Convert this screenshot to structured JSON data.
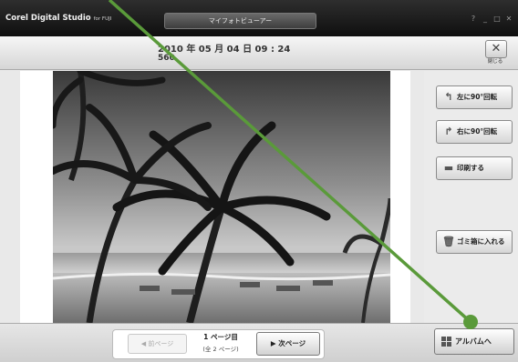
{
  "app": {
    "brand_main": "Corel Digital Studio",
    "brand_sub": "for FUJI",
    "window_title": "マイフォトビューアー"
  },
  "window_controls": [
    "?",
    "_",
    "□",
    "✕"
  ],
  "info": {
    "datetime": "2010 年 05 月 04 日  09 : 24",
    "file_number": "560"
  },
  "close": {
    "icon": "✕",
    "label": "閉じる"
  },
  "side_buttons": [
    {
      "name": "rotate-left-button",
      "icon": "↰",
      "label": "左に90°回転"
    },
    {
      "name": "rotate-right-button",
      "icon": "↱",
      "label": "右に90°回転"
    },
    {
      "name": "print-button",
      "icon": "▬",
      "label": "印刷する"
    },
    {
      "name": "trash-button",
      "icon": "🗑",
      "label": "ゴミ箱に入れる"
    }
  ],
  "pager": {
    "prev_label": "◀ 前ページ",
    "page_label": "1 ページ目",
    "page_sub": "(全 2 ページ)",
    "next_label": "▶ 次ページ"
  },
  "album": {
    "label": "アルバムへ"
  },
  "colors": {
    "annotation": "#5a9a3a",
    "titlebar": "#1a1a1a"
  }
}
